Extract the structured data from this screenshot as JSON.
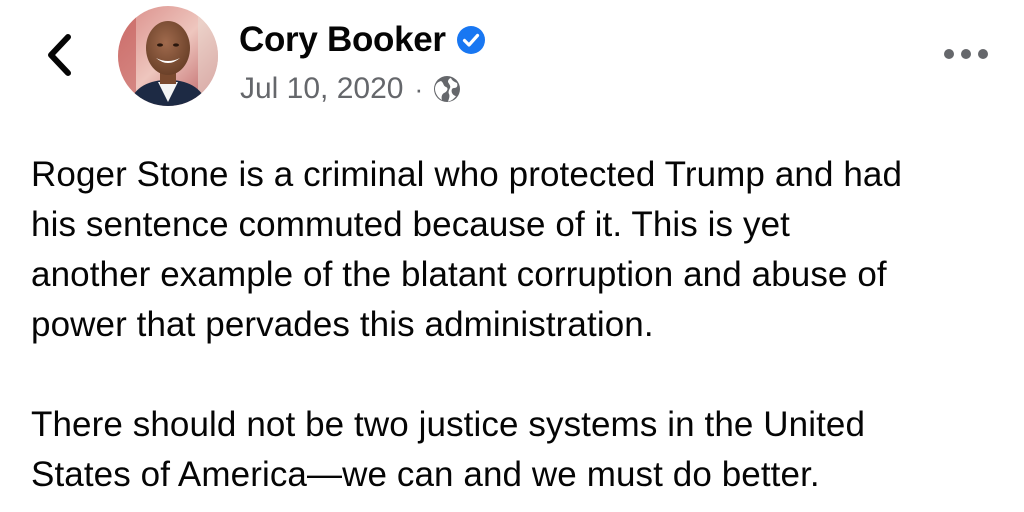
{
  "header": {
    "author_name": "Cory Booker",
    "verified": true,
    "date": "Jul 10, 2020",
    "separator": "·",
    "audience_icon": "globe-icon",
    "back_icon": "chevron-left-icon",
    "more_icon": "more-horizontal-icon"
  },
  "post": {
    "paragraphs": [
      [
        "Roger Stone is a criminal who protected Trump and had",
        "his sentence commuted because of it. This is yet",
        "another example of the blatant corruption and abuse of",
        "power that pervades this administration."
      ],
      [
        "There should not be two justice systems in the United",
        "States of America—we can and we must do better."
      ]
    ]
  },
  "colors": {
    "text": "#050505",
    "secondary_text": "#65676b",
    "verified_badge": "#1877f2",
    "background": "#ffffff"
  }
}
